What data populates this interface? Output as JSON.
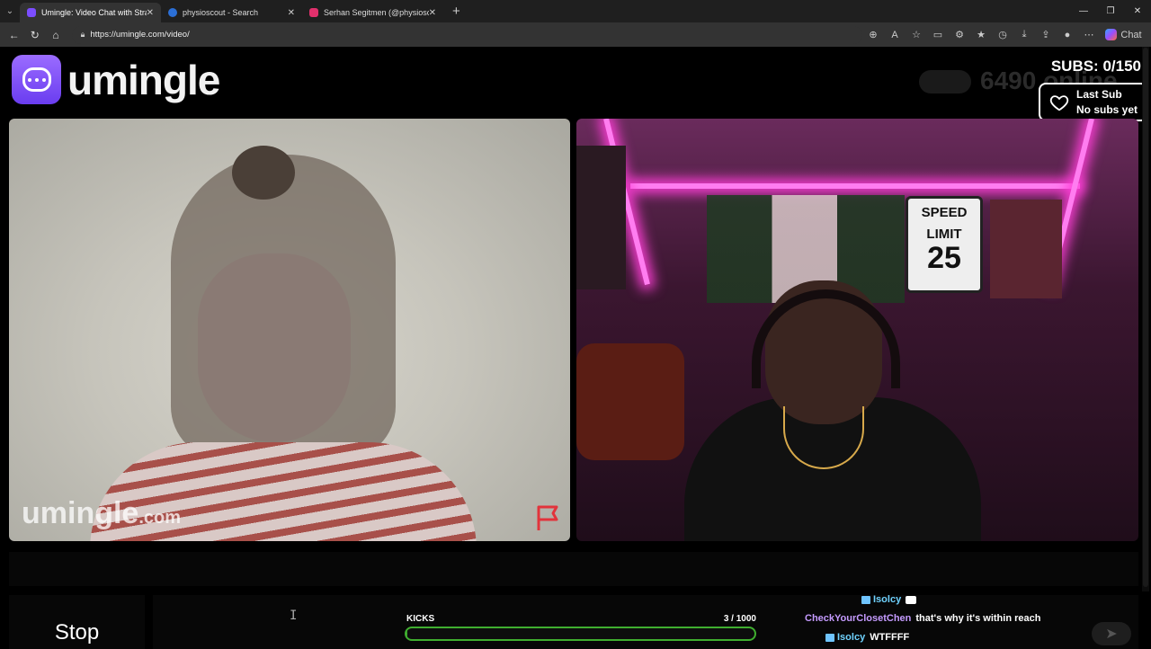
{
  "browser": {
    "tabs": [
      {
        "title": "Umingle: Video Chat with Stra",
        "active": true,
        "favicon_color": "#7b4dff"
      },
      {
        "title": "physioscout - Search",
        "active": false,
        "favicon_color": "#2b6fd6"
      },
      {
        "title": "Serhan Segitmen (@physioscout)",
        "active": false,
        "favicon_color": "#e1306c"
      }
    ],
    "url": "https://umingle.com/video/",
    "copilot_label": "Chat"
  },
  "site": {
    "logo_text": "umingle",
    "online_count": "6490 online",
    "brand_color": "#7b4dff"
  },
  "overlay": {
    "subs_text": "SUBS: 0/150",
    "last_sub_title": "Last Sub",
    "last_sub_value": "No subs yet"
  },
  "video_left": {
    "watermark_main": "umingle",
    "watermark_suffix": ".com"
  },
  "video_right": {
    "sign_line1": "SPEED",
    "sign_line2": "LIMIT",
    "sign_number": "25"
  },
  "controls": {
    "stop_label": "Stop"
  },
  "kicks": {
    "label": "KICKS",
    "count": "3 / 1000",
    "progress": 0.003,
    "color": "#3fae2f"
  },
  "chat": [
    {
      "user": "Isolcy",
      "message": "",
      "emote": true,
      "color": "#6fd2ff"
    },
    {
      "user": "CheckYourClosetChen",
      "message": "that's why it's within reach",
      "emote": false,
      "color": "#c59bff"
    },
    {
      "user": "Isolcy",
      "message": "WTFFFF",
      "emote": false,
      "color": "#6fd2ff"
    }
  ]
}
